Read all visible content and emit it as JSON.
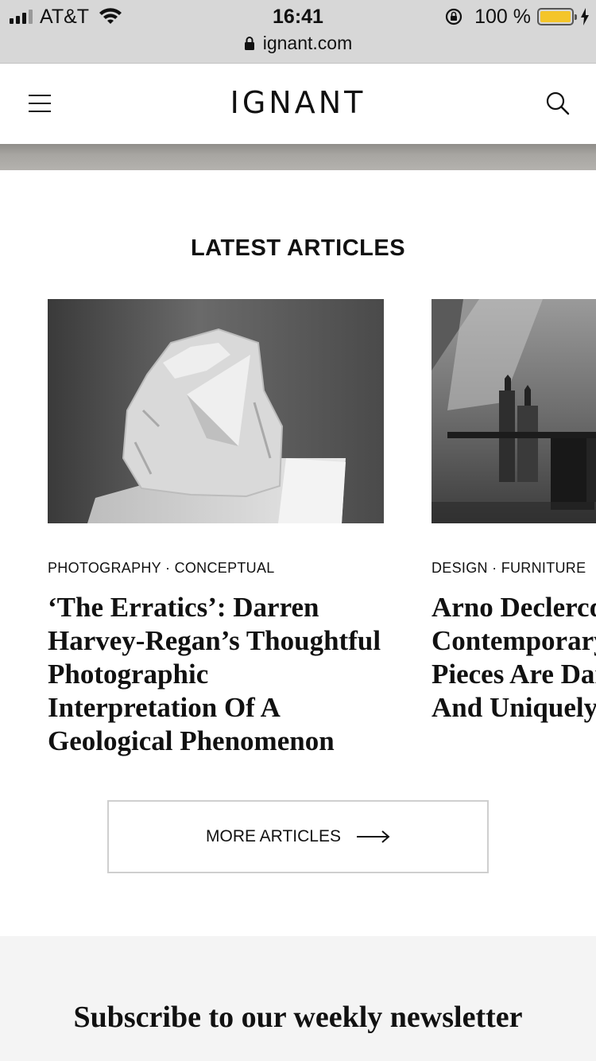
{
  "status_bar": {
    "carrier": "AT&T",
    "time": "16:41",
    "battery": "100 %",
    "url": "ignant.com"
  },
  "header": {
    "logo": "IGNANT"
  },
  "latest": {
    "title": "LATEST ARTICLES",
    "articles": [
      {
        "category": "PHOTOGRAPHY · CONCEPTUAL",
        "title": "‘The Erratics’: Darren Harvey-Regan’s Thoughtful Photographic Interpretation Of A Geological Phenomenon"
      },
      {
        "category": "DESIGN · FURNITURE",
        "title_lines": [
          "Arno Declercq’",
          "Contemporary",
          "Pieces Are Darl",
          "And Uniquely"
        ]
      }
    ]
  },
  "more_button": {
    "label": "MORE ARTICLES"
  },
  "newsletter": {
    "title": "Subscribe to our weekly newsletter"
  }
}
